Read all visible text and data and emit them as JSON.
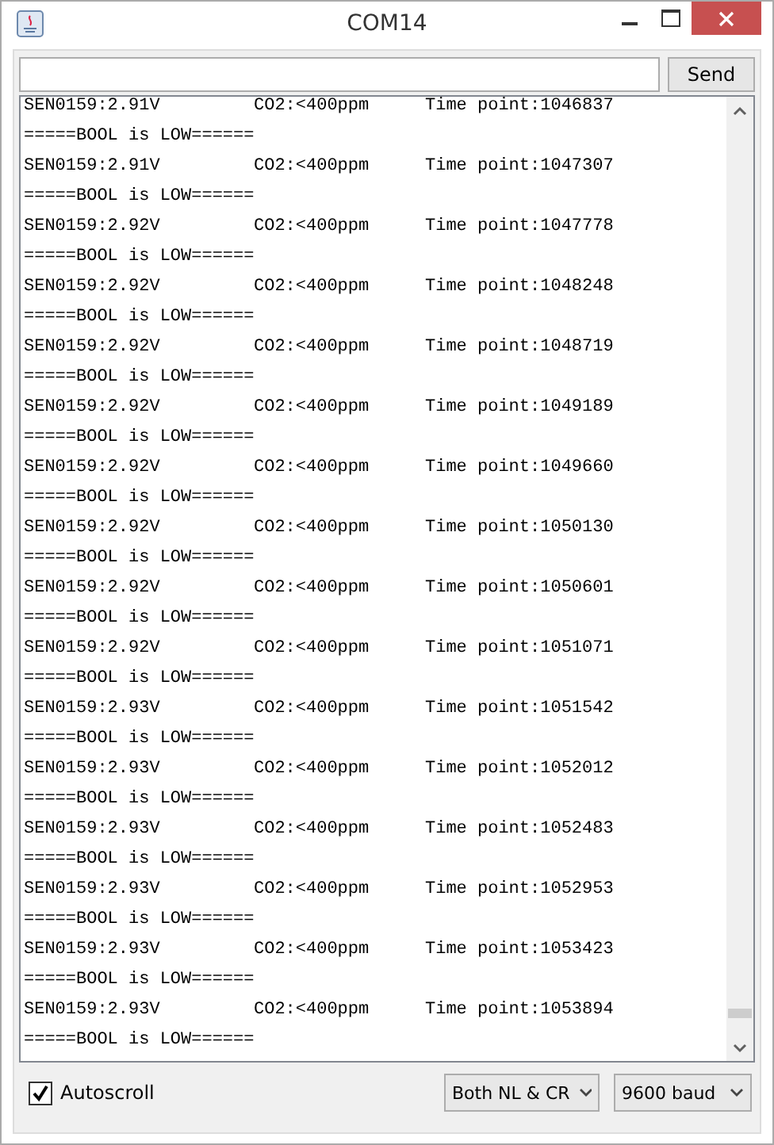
{
  "window": {
    "title": "COM14"
  },
  "send_button": "Send",
  "lines": [
    {
      "kind": "reading",
      "sensor": "SEN0159:2.91V",
      "co2": "CO2:<400ppm",
      "time": "Time point:1046837"
    },
    {
      "kind": "message",
      "text": "=====BOOL is LOW======"
    },
    {
      "kind": "reading",
      "sensor": "SEN0159:2.91V",
      "co2": "CO2:<400ppm",
      "time": "Time point:1047307"
    },
    {
      "kind": "message",
      "text": "=====BOOL is LOW======"
    },
    {
      "kind": "reading",
      "sensor": "SEN0159:2.92V",
      "co2": "CO2:<400ppm",
      "time": "Time point:1047778"
    },
    {
      "kind": "message",
      "text": "=====BOOL is LOW======"
    },
    {
      "kind": "reading",
      "sensor": "SEN0159:2.92V",
      "co2": "CO2:<400ppm",
      "time": "Time point:1048248"
    },
    {
      "kind": "message",
      "text": "=====BOOL is LOW======"
    },
    {
      "kind": "reading",
      "sensor": "SEN0159:2.92V",
      "co2": "CO2:<400ppm",
      "time": "Time point:1048719"
    },
    {
      "kind": "message",
      "text": "=====BOOL is LOW======"
    },
    {
      "kind": "reading",
      "sensor": "SEN0159:2.92V",
      "co2": "CO2:<400ppm",
      "time": "Time point:1049189"
    },
    {
      "kind": "message",
      "text": "=====BOOL is LOW======"
    },
    {
      "kind": "reading",
      "sensor": "SEN0159:2.92V",
      "co2": "CO2:<400ppm",
      "time": "Time point:1049660"
    },
    {
      "kind": "message",
      "text": "=====BOOL is LOW======"
    },
    {
      "kind": "reading",
      "sensor": "SEN0159:2.92V",
      "co2": "CO2:<400ppm",
      "time": "Time point:1050130"
    },
    {
      "kind": "message",
      "text": "=====BOOL is LOW======"
    },
    {
      "kind": "reading",
      "sensor": "SEN0159:2.92V",
      "co2": "CO2:<400ppm",
      "time": "Time point:1050601"
    },
    {
      "kind": "message",
      "text": "=====BOOL is LOW======"
    },
    {
      "kind": "reading",
      "sensor": "SEN0159:2.92V",
      "co2": "CO2:<400ppm",
      "time": "Time point:1051071"
    },
    {
      "kind": "message",
      "text": "=====BOOL is LOW======"
    },
    {
      "kind": "reading",
      "sensor": "SEN0159:2.93V",
      "co2": "CO2:<400ppm",
      "time": "Time point:1051542"
    },
    {
      "kind": "message",
      "text": "=====BOOL is LOW======"
    },
    {
      "kind": "reading",
      "sensor": "SEN0159:2.93V",
      "co2": "CO2:<400ppm",
      "time": "Time point:1052012"
    },
    {
      "kind": "message",
      "text": "=====BOOL is LOW======"
    },
    {
      "kind": "reading",
      "sensor": "SEN0159:2.93V",
      "co2": "CO2:<400ppm",
      "time": "Time point:1052483"
    },
    {
      "kind": "message",
      "text": "=====BOOL is LOW======"
    },
    {
      "kind": "reading",
      "sensor": "SEN0159:2.93V",
      "co2": "CO2:<400ppm",
      "time": "Time point:1052953"
    },
    {
      "kind": "message",
      "text": "=====BOOL is LOW======"
    },
    {
      "kind": "reading",
      "sensor": "SEN0159:2.93V",
      "co2": "CO2:<400ppm",
      "time": "Time point:1053423"
    },
    {
      "kind": "message",
      "text": "=====BOOL is LOW======"
    },
    {
      "kind": "reading",
      "sensor": "SEN0159:2.93V",
      "co2": "CO2:<400ppm",
      "time": "Time point:1053894"
    },
    {
      "kind": "message",
      "text": "=====BOOL is LOW======"
    }
  ],
  "autoscroll": {
    "label": "Autoscroll",
    "checked": true
  },
  "line_ending": "Both NL & CR",
  "baud_rate": "9600 baud"
}
